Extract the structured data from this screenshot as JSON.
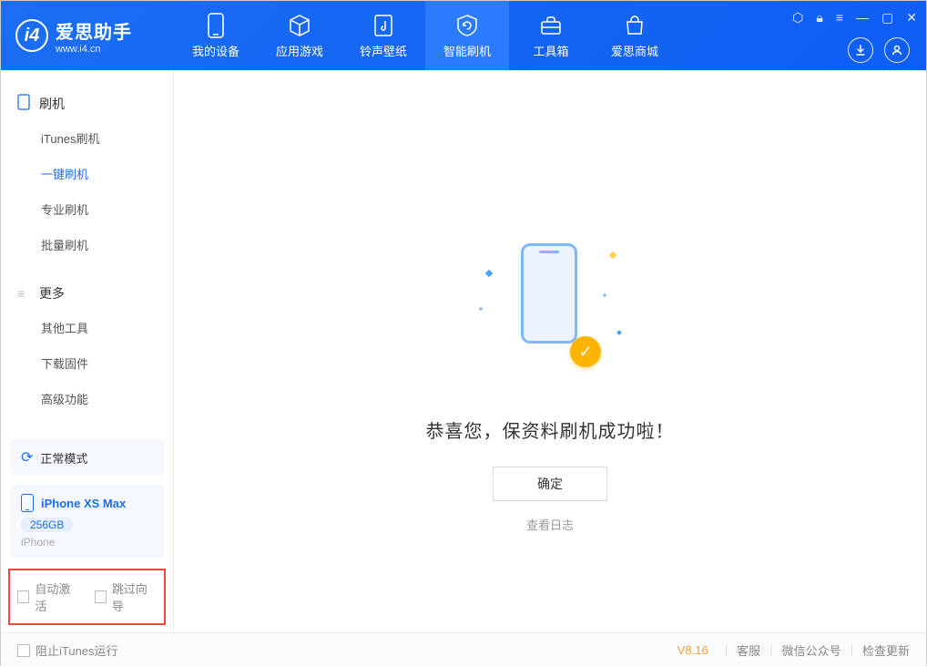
{
  "app": {
    "name_cn": "爱思助手",
    "name_en": "www.i4.cn"
  },
  "nav": [
    {
      "label": "我的设备"
    },
    {
      "label": "应用游戏"
    },
    {
      "label": "铃声壁纸"
    },
    {
      "label": "智能刷机"
    },
    {
      "label": "工具箱"
    },
    {
      "label": "爱思商城"
    }
  ],
  "sidebar": {
    "flash": {
      "title": "刷机",
      "items": [
        {
          "label": "iTunes刷机"
        },
        {
          "label": "一键刷机",
          "active": true
        },
        {
          "label": "专业刷机"
        },
        {
          "label": "批量刷机"
        }
      ]
    },
    "more": {
      "title": "更多",
      "items": [
        {
          "label": "其他工具"
        },
        {
          "label": "下载固件"
        },
        {
          "label": "高级功能"
        }
      ]
    }
  },
  "device": {
    "mode": "正常模式",
    "name": "iPhone XS Max",
    "capacity": "256GB",
    "type": "iPhone"
  },
  "checks": {
    "auto_activate": "自动激活",
    "skip_guide": "跳过向导"
  },
  "main": {
    "success": "恭喜您，保资料刷机成功啦！",
    "ok": "确定",
    "view_log": "查看日志"
  },
  "status": {
    "block_itunes": "阻止iTunes运行",
    "version": "V8.16",
    "links": [
      "客服",
      "微信公众号",
      "检查更新"
    ]
  }
}
